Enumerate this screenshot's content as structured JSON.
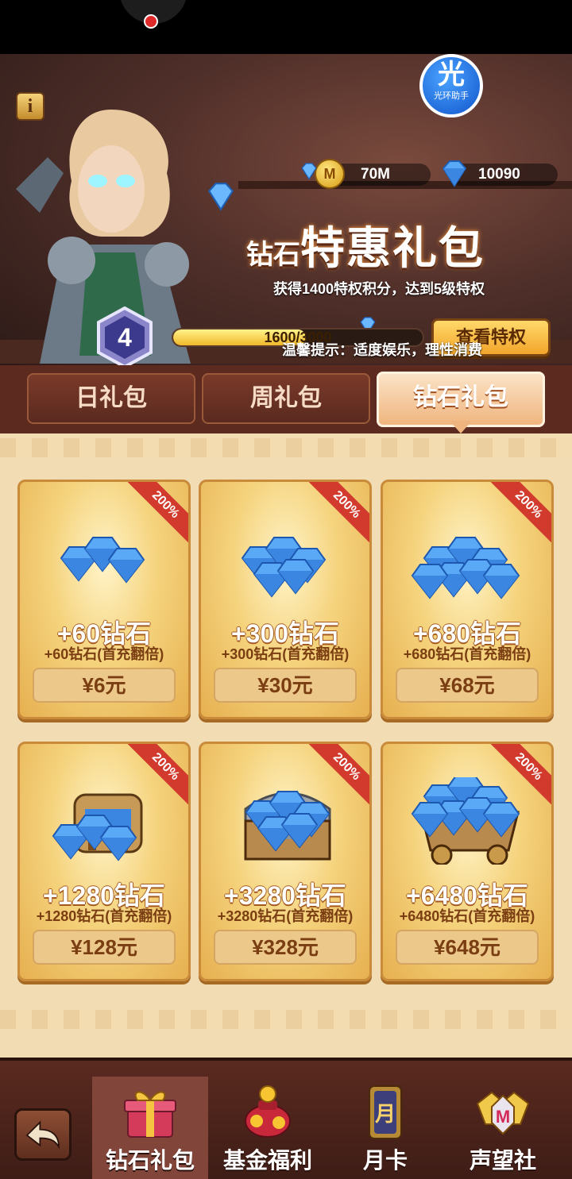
{
  "header": {
    "info_label": "i",
    "assistant": {
      "big": "光",
      "small": "光环助手"
    },
    "coins": "70M",
    "gems": "10090",
    "title_small": "钻石",
    "title_large": "特惠礼包",
    "subtitle": "获得1400特权积分，达到5级特权",
    "vip_level": "4",
    "progress_text": "1600/3000",
    "progress_fraction": 0.5333,
    "privilege_button": "查看特权",
    "tips": "温馨提示：适度娱乐，理性消费"
  },
  "tabs": [
    {
      "label": "日礼包",
      "active": false
    },
    {
      "label": "周礼包",
      "active": false
    },
    {
      "label": "钻石礼包",
      "active": true
    }
  ],
  "packs": [
    {
      "badge": "200%",
      "amount": "+60钻石",
      "bonus": "+60钻石(首充翻倍)",
      "price": "¥6元",
      "art": "gem-pile-small"
    },
    {
      "badge": "200%",
      "amount": "+300钻石",
      "bonus": "+300钻石(首充翻倍)",
      "price": "¥30元",
      "art": "gem-pile-medium"
    },
    {
      "badge": "200%",
      "amount": "+680钻石",
      "bonus": "+680钻石(首充翻倍)",
      "price": "¥68元",
      "art": "gem-pile-large"
    },
    {
      "badge": "200%",
      "amount": "+1280钻石",
      "bonus": "+1280钻石(首充翻倍)",
      "price": "¥128元",
      "art": "gem-backpack"
    },
    {
      "badge": "200%",
      "amount": "+3280钻石",
      "bonus": "+3280钻石(首充翻倍)",
      "price": "¥328元",
      "art": "gem-chest"
    },
    {
      "badge": "200%",
      "amount": "+6480钻石",
      "bonus": "+6480钻石(首充翻倍)",
      "price": "¥648元",
      "art": "gem-minecart"
    }
  ],
  "nav": [
    {
      "label": "钻石礼包",
      "icon": "gift-box-icon",
      "active": true
    },
    {
      "label": "基金福利",
      "icon": "money-bag-icon",
      "active": false
    },
    {
      "label": "月卡",
      "icon": "month-card-icon",
      "active": false
    },
    {
      "label": "声望社",
      "icon": "guild-crest-icon",
      "active": false
    }
  ],
  "colors": {
    "accent": "#f2a52b",
    "ribbon": "#d13a2c",
    "tab_bg": "#5c2a1f",
    "gem": "#4d9cf5"
  }
}
